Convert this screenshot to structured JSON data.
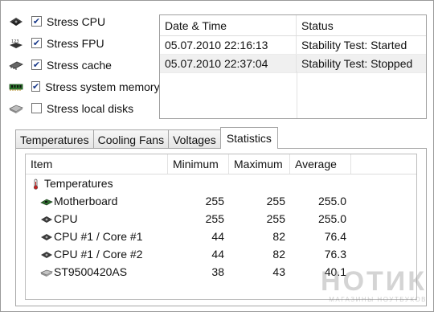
{
  "stress_options": [
    {
      "label": "Stress CPU",
      "checked": true,
      "icon": "cpu-icon"
    },
    {
      "label": "Stress FPU",
      "checked": true,
      "icon": "fpu-icon"
    },
    {
      "label": "Stress cache",
      "checked": true,
      "icon": "cache-icon"
    },
    {
      "label": "Stress system memory",
      "checked": true,
      "icon": "memory-icon"
    },
    {
      "label": "Stress local disks",
      "checked": false,
      "icon": "disk-icon"
    }
  ],
  "check_mark": "✔",
  "log": {
    "columns": [
      "Date & Time",
      "Status"
    ],
    "rows": [
      {
        "datetime": "05.07.2010 22:16:13",
        "status": "Stability Test: Started"
      },
      {
        "datetime": "05.07.2010 22:37:04",
        "status": "Stability Test: Stopped"
      }
    ]
  },
  "tabs": [
    {
      "label": "Temperatures",
      "active": false
    },
    {
      "label": "Cooling Fans",
      "active": false
    },
    {
      "label": "Voltages",
      "active": false
    },
    {
      "label": "Statistics",
      "active": true
    }
  ],
  "stats": {
    "columns": {
      "item": "Item",
      "min": "Minimum",
      "max": "Maximum",
      "avg": "Average"
    },
    "group": {
      "label": "Temperatures",
      "icon": "thermometer-icon"
    },
    "rows": [
      {
        "item": "Motherboard",
        "min": "255",
        "max": "255",
        "avg": "255.0",
        "icon": "motherboard-icon"
      },
      {
        "item": "CPU",
        "min": "255",
        "max": "255",
        "avg": "255.0",
        "icon": "cpu-icon"
      },
      {
        "item": "CPU #1 / Core #1",
        "min": "44",
        "max": "82",
        "avg": "76.4",
        "icon": "cpu-icon"
      },
      {
        "item": "CPU #1 / Core #2",
        "min": "44",
        "max": "82",
        "avg": "76.3",
        "icon": "cpu-icon"
      },
      {
        "item": "ST9500420AS",
        "min": "38",
        "max": "43",
        "avg": "40.1",
        "icon": "disk-icon"
      }
    ]
  },
  "watermark": {
    "title": "НОТИК",
    "subtitle": "МАГАЗИНЫ НОУТБУКОВ"
  },
  "colors": {
    "accent_check": "#1a3a8a",
    "alt_row": "#f0f0f0",
    "border": "#a6a6a6"
  }
}
